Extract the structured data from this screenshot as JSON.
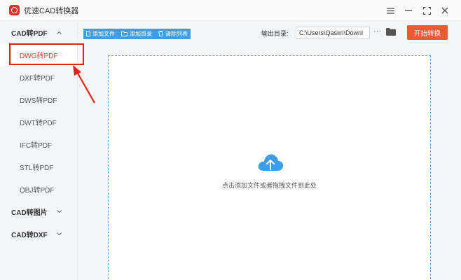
{
  "app": {
    "title": "优速CAD转换器"
  },
  "sidebar": {
    "categories": [
      {
        "label": "CAD转PDF",
        "expanded": true,
        "items": [
          "DWG转PDF",
          "DXF转PDF",
          "DWS转PDF",
          "DWT转PDF",
          "IFC转PDF",
          "STL转PDF",
          "OBJ转PDF"
        ]
      },
      {
        "label": "CAD转图片",
        "expanded": false
      },
      {
        "label": "CAD转DXF",
        "expanded": false
      }
    ],
    "active_item": "DWG转PDF"
  },
  "toolbar": {
    "add_file": "添加文件",
    "add_folder": "添加目录",
    "clear_list": "清除列表",
    "output_label": "输出目录:",
    "output_path": "C:\\Users\\Qasim\\Downl",
    "more": "···",
    "start": "开始转换"
  },
  "dropzone": {
    "hint": "点击添加文件或者拖拽文件到此处"
  },
  "colors": {
    "accent_red": "#ef5a35",
    "accent_blue": "#3c9ee8",
    "annotation": "#e0231b"
  }
}
